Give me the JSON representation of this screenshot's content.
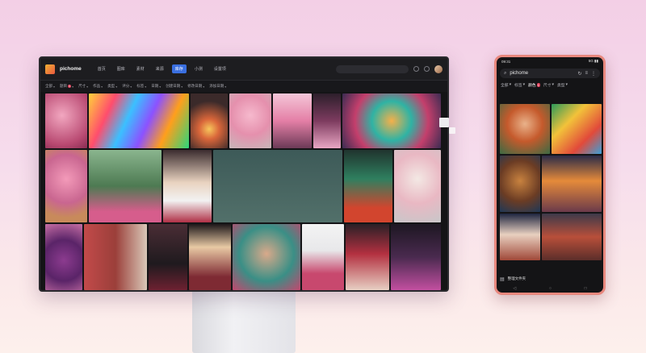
{
  "desktop": {
    "brand": "pichome",
    "nav": [
      "首页",
      "图库",
      "素材",
      "来源",
      "库存",
      "小测",
      "设置项"
    ],
    "active_nav_index": 4,
    "filters": [
      {
        "label": "全部",
        "badge": ""
      },
      {
        "label": "题目",
        "badge": "1"
      },
      {
        "label": "尺寸",
        "badge": ""
      },
      {
        "label": "作品",
        "badge": ""
      },
      {
        "label": "类型",
        "badge": ""
      },
      {
        "label": "评分",
        "badge": ""
      },
      {
        "label": "标签",
        "badge": ""
      },
      {
        "label": "日期",
        "badge": ""
      },
      {
        "label": "创建日期",
        "badge": ""
      },
      {
        "label": "修改日期",
        "badge": ""
      },
      {
        "label": "添加日期",
        "badge": ""
      }
    ]
  },
  "mobile": {
    "time": "09:31",
    "status_right": "5G ▮▮",
    "url": "pichome",
    "filters": [
      {
        "label": "全部",
        "badge": ""
      },
      {
        "label": "标签",
        "badge": ""
      },
      {
        "label": "颜色",
        "badge": "1"
      },
      {
        "label": "尺寸",
        "badge": ""
      },
      {
        "label": "类型",
        "badge": ""
      }
    ],
    "bottom_label": "整理文件夹"
  },
  "icons": {
    "search": "⌕",
    "refresh": "↻",
    "menu": "≡",
    "more": "⋮",
    "chevron": "▾"
  },
  "colors": {
    "accent": "#3a6fe0",
    "badge": "#e0405a",
    "phone_frame": "#e8877d"
  }
}
